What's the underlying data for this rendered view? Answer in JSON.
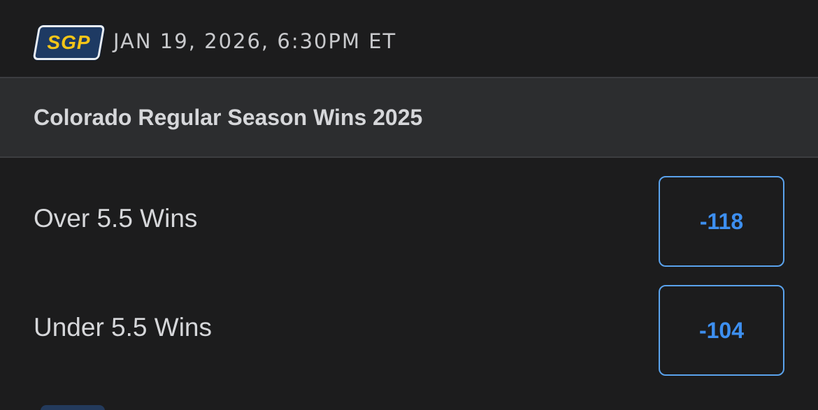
{
  "header": {
    "badge_label": "SGP",
    "game_time": "JAN 19, 2026, 6:30PM ET"
  },
  "market": {
    "title": "Colorado Regular Season Wins 2025"
  },
  "selections": [
    {
      "label": "Over 5.5 Wins",
      "odds": "-118"
    },
    {
      "label": "Under 5.5 Wins",
      "odds": "-104"
    }
  ],
  "colors": {
    "background": "#1c1c1d",
    "market_bar": "#2c2d2f",
    "badge_bg": "#1e3a63",
    "badge_text": "#f5c518",
    "odds_border": "#5aa2ec",
    "odds_text": "#3d8ff0"
  }
}
